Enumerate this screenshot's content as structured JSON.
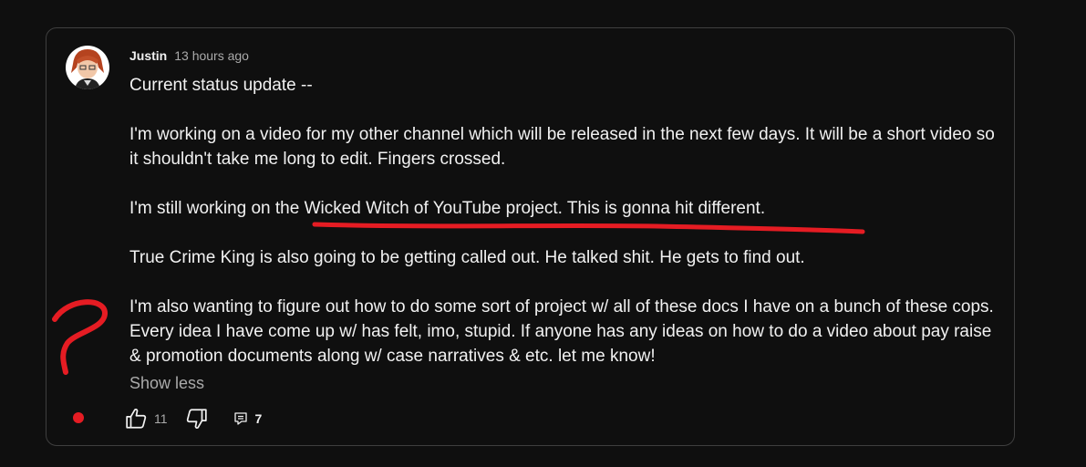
{
  "comment": {
    "author": "Justin",
    "timestamp": "13 hours ago",
    "paragraphs": [
      "Current status update --",
      "I'm working on a video for my other channel which will be released in the next few days. It will be a short video so it shouldn't take me long to edit. Fingers crossed.",
      "I'm still working on the Wicked Witch of YouTube project. This is gonna hit different.",
      "True Crime King is also going to be getting called out. He talked shit. He gets to find out.",
      "I'm also wanting to figure out how to do some sort of project w/ all of these docs I have on a bunch of these cops. Every idea I have come up w/ has felt, imo, stupid. If anyone has any ideas on how to do a video about pay raise & promotion documents along w/ case narratives & etc. let me know!"
    ],
    "show_less_label": "Show less",
    "like_count": "11",
    "reply_count": "7"
  },
  "icons": {
    "like": "thumbs-up-icon",
    "dislike": "thumbs-down-icon",
    "reply": "comment-icon"
  },
  "colors": {
    "background": "#0f0f0f",
    "text": "#f1f1f1",
    "muted": "#aaaaaa",
    "annotation": "#e51c23"
  }
}
